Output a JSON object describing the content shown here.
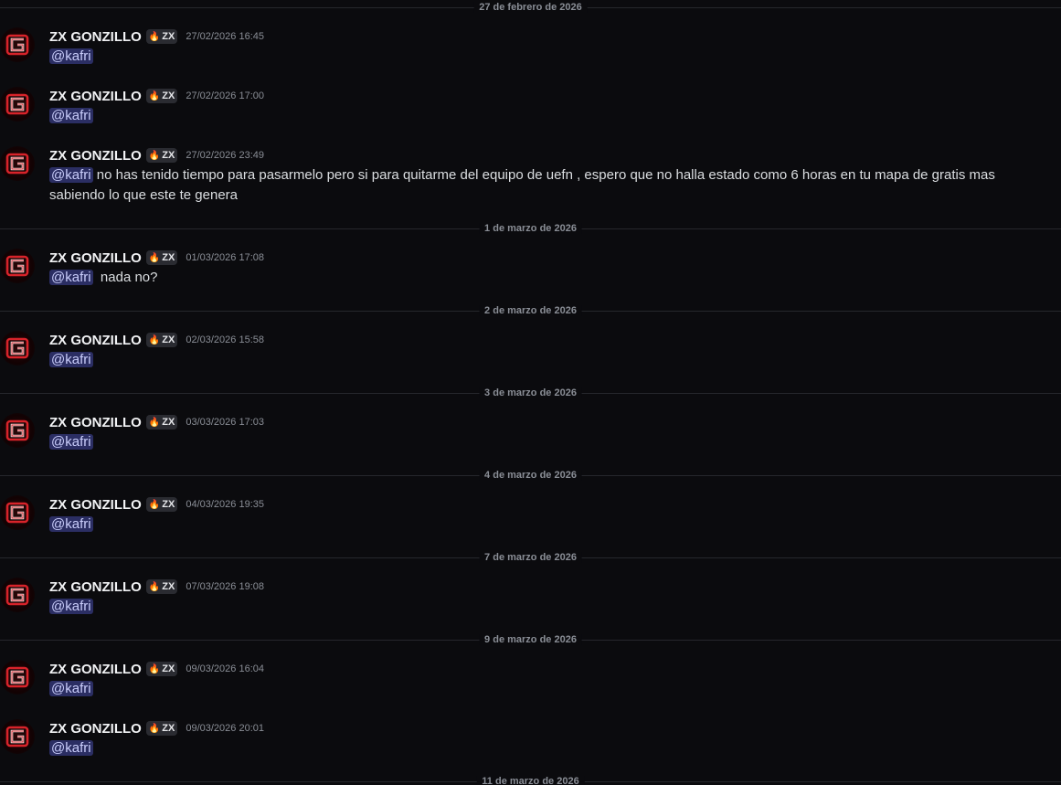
{
  "dividers": [
    {
      "label": "27 de febrero de 2026"
    },
    {
      "label": "1 de marzo de 2026"
    },
    {
      "label": "2 de marzo de 2026"
    },
    {
      "label": "3 de marzo de 2026"
    },
    {
      "label": "4 de marzo de 2026"
    },
    {
      "label": "7 de marzo de 2026"
    },
    {
      "label": "9 de marzo de 2026"
    },
    {
      "label": "11 de marzo de 2026"
    }
  ],
  "user": {
    "name": "ZX GONZILLO",
    "tag_icon": "fire-icon",
    "tag": "ZX",
    "avatar_icon": "g-logo-icon",
    "accent_color": "#d8232a"
  },
  "messages": [
    {
      "timestamp": "27/02/2026 16:45",
      "mention": "@kafri",
      "text": ""
    },
    {
      "timestamp": "27/02/2026 17:00",
      "mention": "@kafri",
      "text": ""
    },
    {
      "timestamp": "27/02/2026 23:49",
      "mention": "@kafri",
      "text": " no has tenido tiempo para pasarmelo pero si para quitarme del equipo de uefn , espero que no halla estado como 6 horas en tu mapa de gratis mas sabiendo lo que este te genera"
    },
    {
      "timestamp": "01/03/2026 17:08",
      "mention": "@kafri",
      "text": "  nada no?"
    },
    {
      "timestamp": "02/03/2026 15:58",
      "mention": "@kafri",
      "text": ""
    },
    {
      "timestamp": "03/03/2026 17:03",
      "mention": "@kafri",
      "text": ""
    },
    {
      "timestamp": "04/03/2026 19:35",
      "mention": "@kafri",
      "text": ""
    },
    {
      "timestamp": "07/03/2026 19:08",
      "mention": "@kafri",
      "text": ""
    },
    {
      "timestamp": "09/03/2026 16:04",
      "mention": "@kafri",
      "text": ""
    },
    {
      "timestamp": "09/03/2026 20:01",
      "mention": "@kafri",
      "text": ""
    }
  ]
}
